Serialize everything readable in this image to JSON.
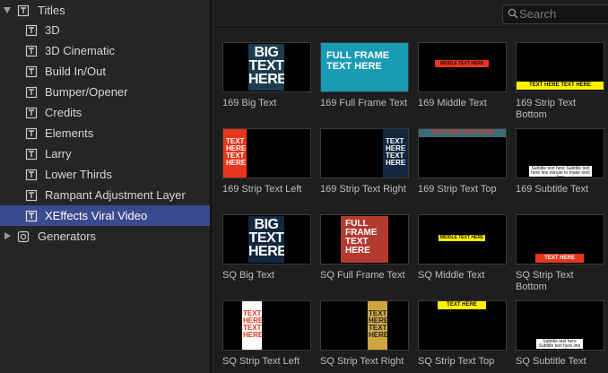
{
  "sidebar": {
    "titles": "Titles",
    "items": [
      "3D",
      "3D Cinematic",
      "Build In/Out",
      "Bumper/Opener",
      "Credits",
      "Elements",
      "Larry",
      "Lower Thirds",
      "Rampant Adjustment Layer",
      "XEffects Viral Video"
    ],
    "generators": "Generators"
  },
  "search": {
    "placeholder": "Search"
  },
  "tiles": [
    {
      "caption": "169 Big Text",
      "text": "BIG TEXT HERE"
    },
    {
      "caption": "169 Full Frame Text",
      "text": "FULL FRAME TEXT HERE"
    },
    {
      "caption": "169 Middle Text",
      "text": "MIDDLE TEXT HERE"
    },
    {
      "caption": "169 Strip Text Bottom",
      "text": "TEXT HERE TEXT HERE"
    },
    {
      "caption": "169 Strip Text Left",
      "text": "TEXT HERE TEXT HERE"
    },
    {
      "caption": "169 Strip Text Right",
      "text": "TEXT HERE TEXT HERE"
    },
    {
      "caption": "169 Strip Text Top",
      "text": "TEXT HERE TEXT HERE"
    },
    {
      "caption": "169 Subtitle Text",
      "text": "Subtitle text here Subtitle text here line minute to make next line"
    },
    {
      "caption": "SQ Big Text",
      "text": "BIG TEXT HERE"
    },
    {
      "caption": "SQ Full Frame Text",
      "text": "FULL FRAME TEXT HERE"
    },
    {
      "caption": "SQ Middle Text",
      "text": "MIDDLE TEXT HERE"
    },
    {
      "caption": "SQ Strip Text Bottom",
      "text": "TEXT HERE"
    },
    {
      "caption": "SQ Strip Text Left",
      "text": "TEXT HERE TEXT HERE"
    },
    {
      "caption": "SQ Strip Text Right",
      "text": "TEXT HERE TEXT HERE"
    },
    {
      "caption": "SQ Strip Text Top",
      "text": "TEXT HERE"
    },
    {
      "caption": "SQ Subtitle Text",
      "text": "Subtitle text here Subtitle text here line minute to make next line"
    }
  ],
  "colors": {
    "selection": "#3a4a8c",
    "sidebar_bg": "#252525",
    "browser_bg": "#1e1e1e",
    "teal": "#1a9bb5",
    "red": "#e8361c",
    "yellow": "#fff200",
    "navy": "#13283f",
    "brick": "#b33a2e",
    "gold": "#cfa540",
    "slate": "#1d3d4e"
  }
}
